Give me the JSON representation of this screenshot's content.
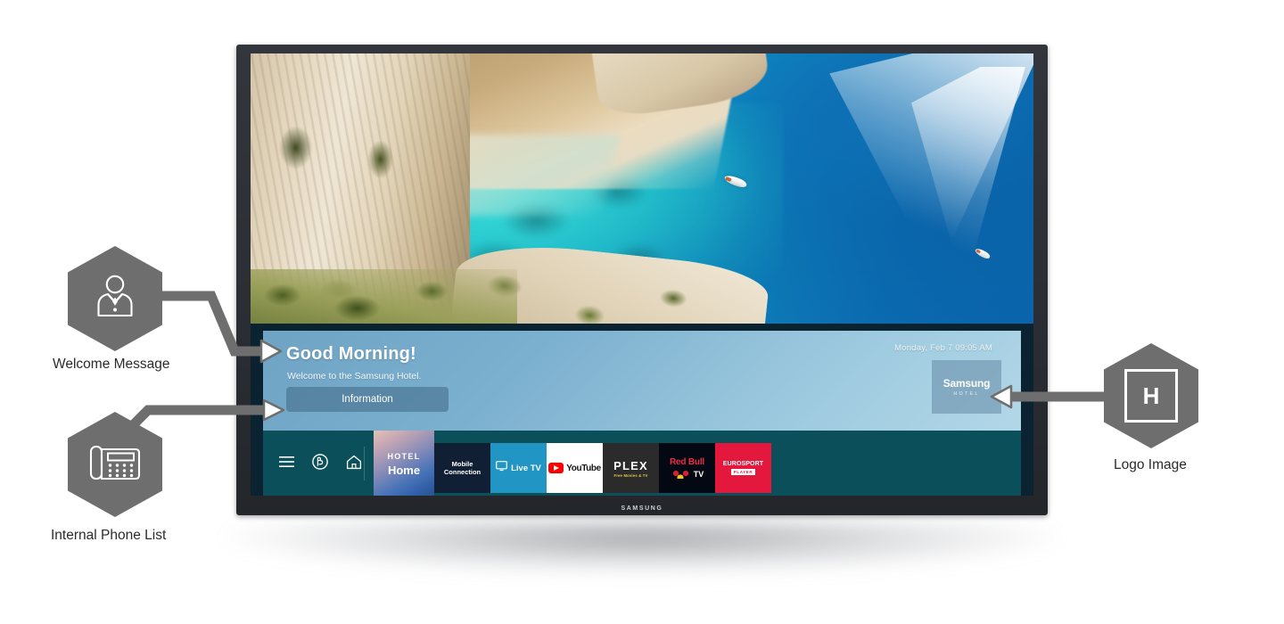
{
  "page": {
    "title": "Samsung Hotel TV Home Screen"
  },
  "tv": {
    "brand": "SAMSUNG"
  },
  "welcome_panel": {
    "greeting": "Good Morning!",
    "subtext": "Welcome to the Samsung Hotel.",
    "information_button": "Information",
    "datetime": "Monday, Feb 7  09:05 AM",
    "logo": {
      "main": "Samsung",
      "sub": "HOTEL"
    }
  },
  "dock": {
    "nav_icons": [
      {
        "name": "menu-icon",
        "label": "Menu"
      },
      {
        "name": "bixby-icon",
        "label": "Bixby"
      },
      {
        "name": "home-icon",
        "label": "Home"
      }
    ],
    "tiles": [
      {
        "name": "hotel-home",
        "line1": "HOTEL",
        "line2": "Home"
      },
      {
        "name": "mobile-connection",
        "line1": "Mobile",
        "line2": "Connection"
      },
      {
        "name": "live-tv",
        "label": "Live TV"
      },
      {
        "name": "youtube",
        "label": "YouTube"
      },
      {
        "name": "plex",
        "label": "PLEX",
        "sub": "Free Movies & TV"
      },
      {
        "name": "red-bull-tv",
        "line1": "Red Bull",
        "line2": "TV"
      },
      {
        "name": "eurosport",
        "label": "EUROSPORT",
        "sub": "PLAYER"
      }
    ]
  },
  "annotations": [
    {
      "name": "welcome-message",
      "label": "Welcome Message",
      "icon": "concierge-icon"
    },
    {
      "name": "internal-phone-list",
      "label": "Internal Phone List",
      "icon": "desk-phone-icon"
    },
    {
      "name": "logo-image",
      "label": "Logo Image",
      "icon": "logo-placeholder-icon",
      "glyph": "H"
    }
  ],
  "colors": {
    "dock_teal": "#0a4f5a",
    "panel_blue": "#7cb0cf",
    "annotation_grey": "#6e6e6e",
    "bezel": "#2b2e34"
  }
}
